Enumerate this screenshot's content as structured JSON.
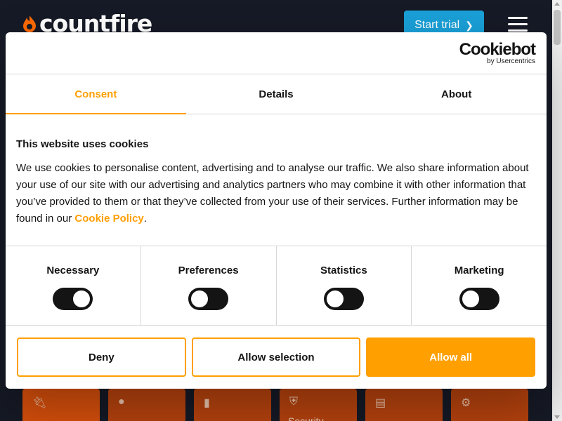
{
  "site": {
    "logo_text": "countfire",
    "start_trial_label": "Start trial",
    "cards": [
      {
        "icon": "plug-icon",
        "label": ""
      },
      {
        "icon": "lightbulb-icon",
        "label": ""
      },
      {
        "icon": "extinguisher-icon",
        "label": ""
      },
      {
        "icon": "shield-icon",
        "label": "Security"
      },
      {
        "icon": "server-icon",
        "label": ""
      },
      {
        "icon": "gears-icon",
        "label": ""
      }
    ]
  },
  "dialog": {
    "brand_name": "Cookiebot",
    "brand_sub": "by Usercentrics",
    "tabs": [
      {
        "label": "Consent",
        "active": true
      },
      {
        "label": "Details",
        "active": false
      },
      {
        "label": "About",
        "active": false
      }
    ],
    "title": "This website uses cookies",
    "body_text": "We use cookies to personalise content, advertising and to analyse our traffic. We also share information about your use of our site with our advertising and analytics partners who may combine it with other information that you’ve provided to them or that they’ve collected from your use of their services. Further information may be found in our ",
    "policy_link": "Cookie Policy",
    "body_end": ".",
    "toggles": [
      {
        "label": "Necessary",
        "on": true
      },
      {
        "label": "Preferences",
        "on": false
      },
      {
        "label": "Statistics",
        "on": false
      },
      {
        "label": "Marketing",
        "on": false
      }
    ],
    "buttons": {
      "deny": "Deny",
      "allow_selection": "Allow selection",
      "allow_all": "Allow all"
    }
  },
  "colors": {
    "accent": "#ff9f00",
    "trial_button": "#1aa0d8",
    "page_bg": "#161a26",
    "card": "#b8430e"
  }
}
